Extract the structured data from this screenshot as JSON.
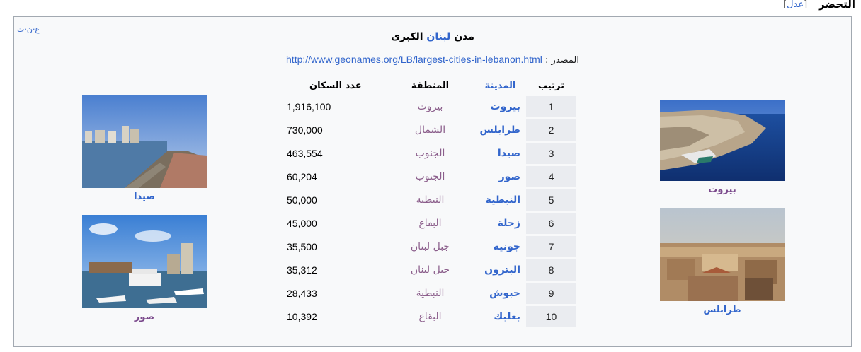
{
  "section": {
    "title": "التحضر",
    "edit_open": "[",
    "edit_label": "عدل",
    "edit_close": "]"
  },
  "navbox": {
    "vte": [
      "ع",
      "ن",
      "ت"
    ],
    "title_pre": "مدن ",
    "title_link": "لبنان",
    "title_post": " الكبرى",
    "source_label": "المصدر : ",
    "source_url": "http://www.geonames.org/LB/largest-cities-in-lebanon.html"
  },
  "table": {
    "headers": {
      "rank": "ترتيب",
      "city": "المدينة",
      "region": "المنطقة",
      "population": "عدد السكان"
    },
    "rows": [
      {
        "rank": "1",
        "city": "بيروت",
        "region": "بيروت",
        "population": "1,916,100"
      },
      {
        "rank": "2",
        "city": "طرابلس",
        "region": "الشمال",
        "population": "730,000"
      },
      {
        "rank": "3",
        "city": "صيدا",
        "region": "الجنوب",
        "population": "463,554"
      },
      {
        "rank": "4",
        "city": "صور",
        "region": "الجنوب",
        "population": "60,204"
      },
      {
        "rank": "5",
        "city": "النبطية",
        "region": "النبطية",
        "population": "50,000"
      },
      {
        "rank": "6",
        "city": "زحلة",
        "region": "البقاع",
        "population": "45,000"
      },
      {
        "rank": "7",
        "city": "جونيه",
        "region": "جبل لبنان",
        "population": "35,500"
      },
      {
        "rank": "8",
        "city": "البترون",
        "region": "جبل لبنان",
        "population": "35,312"
      },
      {
        "rank": "9",
        "city": "حبوش",
        "region": "النبطية",
        "population": "28,433"
      },
      {
        "rank": "10",
        "city": "بعلبك",
        "region": "البقاع",
        "population": "10,392"
      }
    ]
  },
  "photos": {
    "beirut": "بيروت",
    "tripoli": "طرابلس",
    "sidon": "صيدا",
    "tyre": "صور"
  }
}
